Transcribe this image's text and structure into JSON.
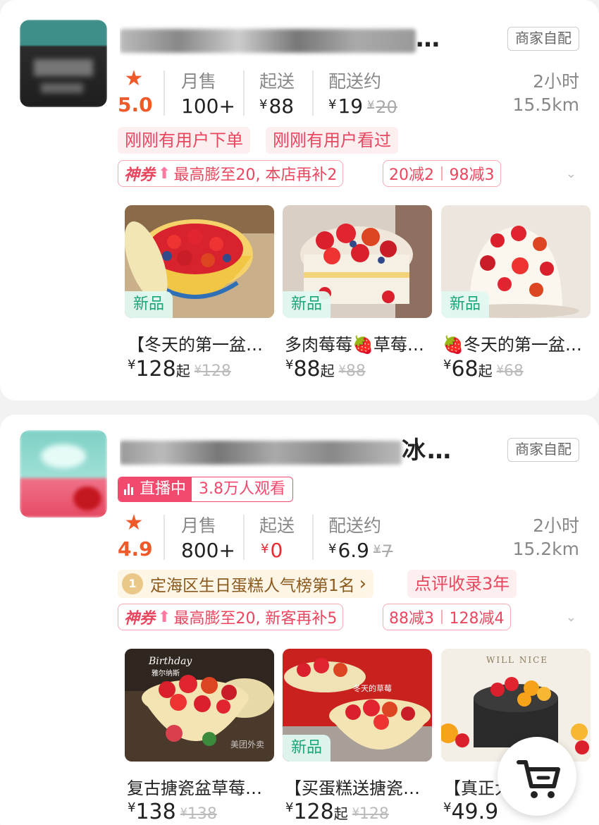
{
  "colors": {
    "accent_red": "#ec2a32",
    "pink": "#e9475f",
    "star_orange": "#f05a2a",
    "new_green": "#1aa67a"
  },
  "shops": [
    {
      "name_ellipsis": "…",
      "delivery_tag": "商家自配",
      "rating": "5.0",
      "stats": {
        "sales_label": "月售",
        "sales": "100+",
        "min_label": "起送",
        "min_yen": "¥",
        "min": "88",
        "fee_label": "配送约",
        "fee_yen": "¥",
        "fee": "19",
        "fee_orig_yen": "¥",
        "fee_orig": "20"
      },
      "time": "2小时",
      "distance": "15.5km",
      "pills": [
        "刚刚有用户下单",
        "刚刚有用户看过"
      ],
      "coupon": {
        "shen": "神券",
        "text": "最高膨至20, 本店再补2"
      },
      "discounts": [
        "20减2",
        "98减3"
      ],
      "products": [
        {
          "badge": "新品",
          "name": "【冬天的第一盆草莓…",
          "yen": "¥",
          "price": "128",
          "qi": "起",
          "orig": "128"
        },
        {
          "badge": "新品",
          "name": "多肉莓莓🍓草莓蛋糕",
          "yen": "¥",
          "price": "88",
          "qi": "起",
          "orig": "88"
        },
        {
          "badge": "新品",
          "name": "🍓冬天的第一盆草莓",
          "yen": "¥",
          "price": "68",
          "qi": "起",
          "orig": "68"
        }
      ]
    },
    {
      "name_suffix": "冰…",
      "delivery_tag": "商家自配",
      "live": {
        "label": "直播中",
        "viewers": "3.8万人观看"
      },
      "rating": "4.9",
      "stats": {
        "sales_label": "月售",
        "sales": "800+",
        "min_label": "起送",
        "min_yen": "¥",
        "min": "0",
        "fee_label": "配送约",
        "fee_yen": "¥",
        "fee": "6.9",
        "fee_orig_yen": "¥",
        "fee_orig": "7"
      },
      "time": "2小时",
      "distance": "15.2km",
      "rank": "定海区生日蛋糕人气榜第1名",
      "rank_arrow": "›",
      "pills": [
        "点评收录3年"
      ],
      "coupon": {
        "shen": "神券",
        "text": "最高膨至20, 新客再补5"
      },
      "discounts": [
        "88减3",
        "128减4"
      ],
      "products": [
        {
          "badge": "",
          "name": "复古搪瓷盆草莓蛋糕",
          "yen": "¥",
          "price": "138",
          "qi": "",
          "orig": "138",
          "img_text_1": "Birthday",
          "img_text_2": "雅尔纳斯",
          "watermark": "美团外卖"
        },
        {
          "badge": "新品",
          "name": "【买蛋糕送搪瓷盆】",
          "yen": "¥",
          "price": "128",
          "qi": "起",
          "orig": "128",
          "img_text_1": "冬天的草莓"
        },
        {
          "badge": "",
          "name": "【真正大草莓】",
          "yen": "¥",
          "price": "49.9",
          "qi": "",
          "orig": "",
          "img_text_1": "WILL NICE"
        }
      ]
    }
  ]
}
